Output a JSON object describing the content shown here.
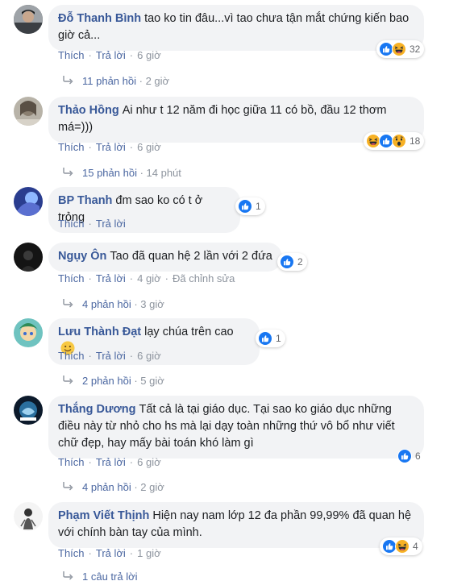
{
  "labels": {
    "like": "Thích",
    "reply": "Trả lời",
    "edited": "Đã chỉnh sửa"
  },
  "colors": {
    "link": "#385898",
    "bubble": "#f2f3f5",
    "like_blue": "#1877f2",
    "haha_yellow": "#f7b125"
  },
  "comments": [
    {
      "author": "Đỗ Thanh Bình",
      "text": "tao ko tin đâu...vì tao chưa tận mắt chứng kiến bao giờ cả...",
      "time": "6 giờ",
      "reactions": [
        "like-icon",
        "haha-icon"
      ],
      "reaction_count": "32",
      "replies": "11 phản hồi",
      "replies_time": "2 giờ"
    },
    {
      "author": "Thảo Hồng",
      "text": "Ai như t 12 năm đi học giữa 11 có bồ, đầu 12 thơm má=)))",
      "time": "6 giờ",
      "reactions": [
        "haha-icon",
        "like-icon",
        "wow-icon"
      ],
      "reaction_count": "18",
      "replies": "15 phản hồi",
      "replies_time": "14 phút"
    },
    {
      "author": "BP Thanh",
      "text": "đm sao ko có t ở trỏng",
      "time": "",
      "reactions": [
        "like-icon"
      ],
      "reaction_count": "1"
    },
    {
      "author": "Ngụy Ôn",
      "text": "Tao đã quan hệ 2 lần với 2 đứa",
      "time": "4 giờ",
      "reactions": [
        "like-icon"
      ],
      "reaction_count": "2",
      "replies": "4 phản hồi",
      "replies_time": "3 giờ"
    },
    {
      "author": "Lưu Thành Đạt",
      "text": "lạy chúa trên cao",
      "time": "6 giờ",
      "reactions": [
        "like-icon"
      ],
      "reaction_count": "1",
      "replies": "2 phản hồi",
      "replies_time": "5 giờ"
    },
    {
      "author": "Thắng Dương",
      "text": "Tất cả là tại giáo dục. Tại sao ko giáo dục những điều này từ nhỏ cho hs mà lại dạy toàn những thứ vô bổ như viết chữ đẹp, hay mấy bài toán khó làm gì",
      "time": "6 giờ",
      "reactions": [
        "like-icon"
      ],
      "reaction_count": "6",
      "replies": "4 phản hồi",
      "replies_time": "2 giờ"
    },
    {
      "author": "Phạm Viết Thịnh",
      "text": "Hiện nay nam lớp 12 đa phần 99,99% đã quan hệ với chính bàn tay của mình.",
      "time": "1 giờ",
      "reactions": [
        "like-icon",
        "haha-icon"
      ],
      "reaction_count": "4",
      "replies": "1 câu trả lời"
    }
  ]
}
